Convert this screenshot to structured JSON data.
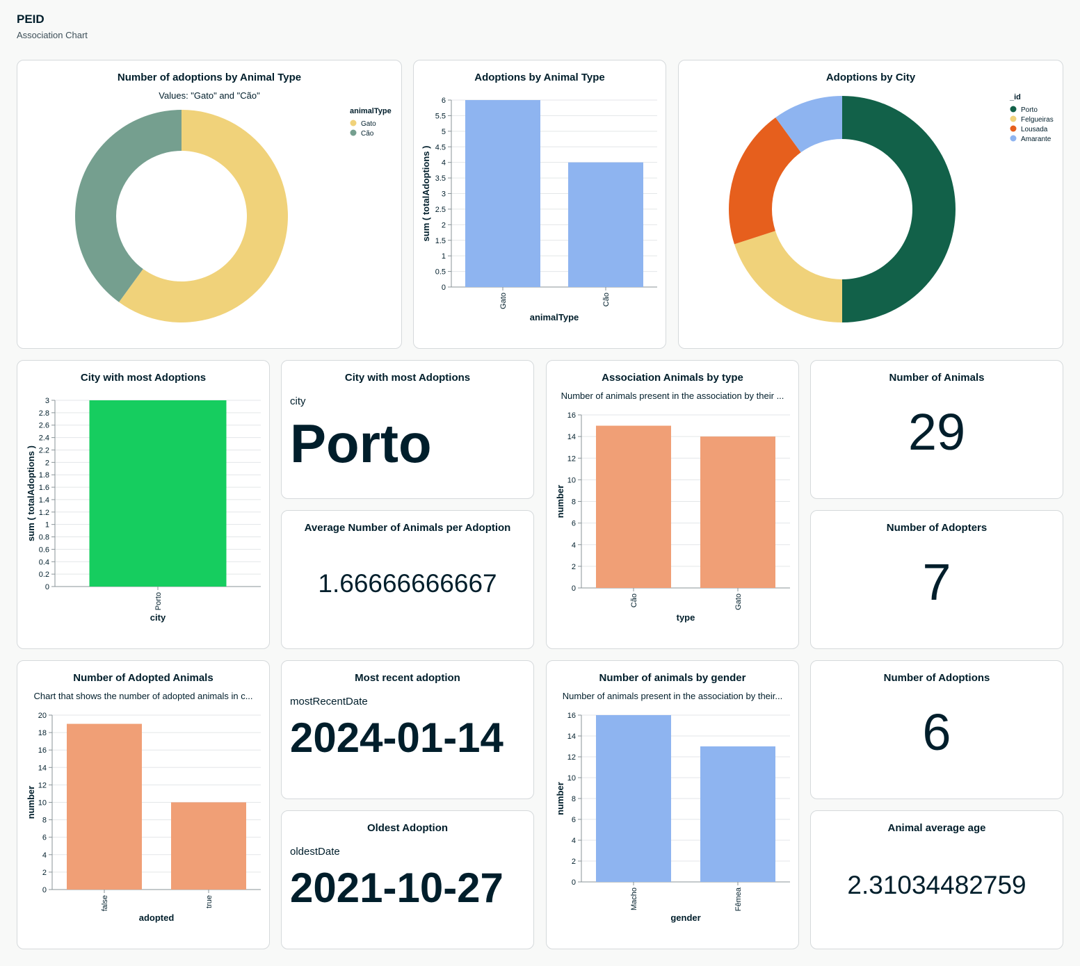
{
  "header": {
    "title": "PEID",
    "subtitle": "Association Chart"
  },
  "cards": {
    "adoptions_type_donut": {
      "title": "Number of adoptions by Animal Type",
      "subtitle": "Values: \"Gato\" and \"Cão\""
    },
    "adoptions_type_bar": {
      "title": "Adoptions by Animal Type"
    },
    "adoptions_city_donut": {
      "title": "Adoptions by City"
    },
    "city_most_bar": {
      "title": "City with most Adoptions"
    },
    "city_most_kpi": {
      "title": "City with most Adoptions",
      "label": "city",
      "value": "Porto"
    },
    "avg_animals": {
      "title": "Average Number of Animals per Adoption",
      "value": "1.66666666667"
    },
    "animals_by_type": {
      "title": "Association Animals by type",
      "subtitle": "Number of animals present in the association by their ..."
    },
    "num_animals": {
      "title": "Number of Animals",
      "value": "29"
    },
    "num_adopters": {
      "title": "Number of Adopters",
      "value": "7"
    },
    "adopted_animals": {
      "title": "Number of Adopted Animals",
      "subtitle": "Chart that shows the number of adopted animals in c..."
    },
    "recent_adoption": {
      "title": "Most recent adoption",
      "label": "mostRecentDate",
      "value": "2024-01-14"
    },
    "oldest_adoption": {
      "title": "Oldest Adoption",
      "label": "oldestDate",
      "value": "2021-10-27"
    },
    "animals_by_gender": {
      "title": "Number of animals by gender",
      "subtitle": "Number of animals present in the association by their..."
    },
    "num_adoptions": {
      "title": "Number of Adoptions",
      "value": "6"
    },
    "avg_age": {
      "title": "Animal average age",
      "value": "2.31034482759"
    }
  },
  "chart_data": [
    {
      "id": "donut_type",
      "type": "pie",
      "donut": true,
      "legend_title": "animalType",
      "legend_position": "top-right",
      "slices": [
        {
          "label": "Gato",
          "value": 6,
          "color": "#f0d27a"
        },
        {
          "label": "Cão",
          "value": 4,
          "color": "#759f8f"
        }
      ]
    },
    {
      "id": "bar_type",
      "type": "bar",
      "categories": [
        "Gato",
        "Cão"
      ],
      "values": [
        6,
        4
      ],
      "color": "#8eb4f0",
      "xlabel": "animalType",
      "ylabel": "sum ( totalAdoptions )",
      "ylim": [
        0,
        6
      ],
      "yticks": [
        "0",
        "0.5",
        "1",
        "1.5",
        "2",
        "2.5",
        "3",
        "3.5",
        "4",
        "4.5",
        "5",
        "5.5",
        "6"
      ],
      "grid": true
    },
    {
      "id": "donut_city",
      "type": "pie",
      "donut": true,
      "legend_title": "_id",
      "legend_position": "top-right",
      "slices": [
        {
          "label": "Porto",
          "value": 3,
          "color": "#126149"
        },
        {
          "label": "Felgueiras",
          "value": 1.2,
          "color": "#f0d27a"
        },
        {
          "label": "Lousada",
          "value": 1.2,
          "color": "#e65f1d"
        },
        {
          "label": "Amarante",
          "value": 0.6,
          "color": "#8eb4f0"
        }
      ]
    },
    {
      "id": "bar_city",
      "type": "bar",
      "categories": [
        "Porto"
      ],
      "values": [
        3
      ],
      "color": "#16cd5f",
      "xlabel": "city",
      "ylabel": "sum ( totalAdoptions )",
      "ylim": [
        0,
        3
      ],
      "yticks": [
        "0",
        "0.2",
        "0.4",
        "0.6",
        "0.8",
        "1",
        "1.2",
        "1.4",
        "1.6",
        "1.8",
        "2",
        "2.2",
        "2.4",
        "2.6",
        "2.8",
        "3"
      ],
      "grid": true
    },
    {
      "id": "bar_animal_type",
      "type": "bar",
      "categories": [
        "Cão",
        "Gato"
      ],
      "values": [
        15,
        14
      ],
      "color": "#f09f76",
      "xlabel": "type",
      "ylabel": "number",
      "ylim": [
        0,
        16
      ],
      "yticks": [
        "0",
        "2",
        "4",
        "6",
        "8",
        "10",
        "12",
        "14",
        "16"
      ],
      "grid": true
    },
    {
      "id": "bar_adopted",
      "type": "bar",
      "categories": [
        "false",
        "true"
      ],
      "values": [
        19,
        10
      ],
      "color": "#f09f76",
      "xlabel": "adopted",
      "ylabel": "number",
      "ylim": [
        0,
        20
      ],
      "yticks": [
        "0",
        "2",
        "4",
        "6",
        "8",
        "10",
        "12",
        "14",
        "16",
        "18",
        "20"
      ],
      "grid": true
    },
    {
      "id": "bar_gender",
      "type": "bar",
      "categories": [
        "Macho",
        "Fêmea"
      ],
      "values": [
        16,
        13
      ],
      "color": "#8eb4f0",
      "xlabel": "gender",
      "ylabel": "number",
      "ylim": [
        0,
        16
      ],
      "yticks": [
        "0",
        "2",
        "4",
        "6",
        "8",
        "10",
        "12",
        "14",
        "16"
      ],
      "grid": true
    }
  ]
}
